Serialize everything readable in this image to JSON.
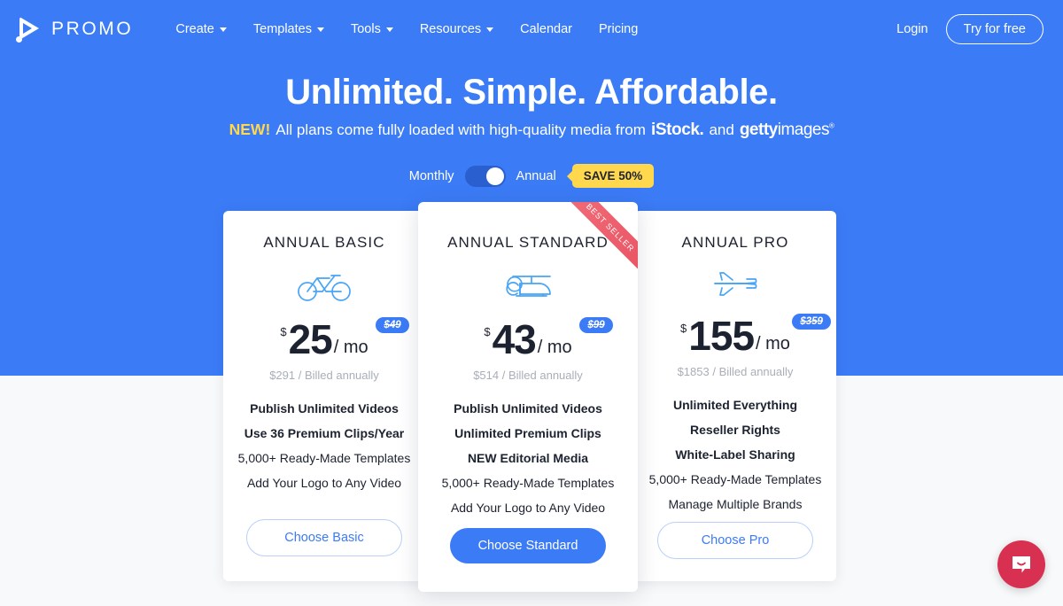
{
  "brand": {
    "name": "PROMO",
    "logo_icon": "play-triangle-icon"
  },
  "nav": {
    "items": [
      {
        "label": "Create",
        "has_caret": true
      },
      {
        "label": "Templates",
        "has_caret": true
      },
      {
        "label": "Tools",
        "has_caret": true
      },
      {
        "label": "Resources",
        "has_caret": true
      },
      {
        "label": "Calendar",
        "has_caret": false
      },
      {
        "label": "Pricing",
        "has_caret": false
      }
    ],
    "login_label": "Login",
    "try_label": "Try for free"
  },
  "hero": {
    "headline": "Unlimited. Simple. Affordable.",
    "new_flag": "NEW!",
    "subline_text": "All plans come fully loaded with high-quality media from",
    "partner_one": "iStock.",
    "conjunction": "and",
    "partner_two_bold": "getty",
    "partner_two_light": "images"
  },
  "billing": {
    "monthly_label": "Monthly",
    "annual_label": "Annual",
    "selected": "Annual",
    "save_badge": "SAVE 50%"
  },
  "colors": {
    "hero_blue": "#3b7bf6",
    "page_bg": "#f8f9fa",
    "accent_yellow": "#ffd84d",
    "ribbon_red": "#e8505f",
    "chat_red": "#d83050",
    "muted_gray": "#a9aeb8"
  },
  "plans": [
    {
      "id": "basic",
      "title": "ANNUAL BASIC",
      "icon": "bicycle-icon",
      "currency": "$",
      "amount": "25",
      "per": "/ mo",
      "old_price": "$49",
      "billed": "$291 / Billed annually",
      "features": [
        {
          "text": "Publish Unlimited Videos",
          "bold": true
        },
        {
          "text": "Use 36 Premium Clips/Year",
          "bold": true
        },
        {
          "text": "5,000+ Ready-Made Templates",
          "bold": false
        },
        {
          "text": "Add Your Logo to Any Video",
          "bold": false
        }
      ],
      "cta": "Choose Basic",
      "highlighted": false,
      "ribbon": null
    },
    {
      "id": "standard",
      "title": "ANNUAL STANDARD",
      "icon": "helicopter-icon",
      "currency": "$",
      "amount": "43",
      "per": "/ mo",
      "old_price": "$99",
      "billed": "$514 / Billed annually",
      "features": [
        {
          "text": "Publish Unlimited Videos",
          "bold": true
        },
        {
          "text": "Unlimited Premium Clips",
          "bold": true
        },
        {
          "text": "NEW Editorial Media",
          "bold": true
        },
        {
          "text": "5,000+ Ready-Made Templates",
          "bold": false
        },
        {
          "text": "Add Your Logo to Any Video",
          "bold": false
        }
      ],
      "cta": "Choose Standard",
      "highlighted": true,
      "ribbon": "BEST SELLER"
    },
    {
      "id": "pro",
      "title": "ANNUAL PRO",
      "icon": "airplane-icon",
      "currency": "$",
      "amount": "155",
      "per": "/ mo",
      "old_price": "$359",
      "billed": "$1853 / Billed annually",
      "features": [
        {
          "text": "Unlimited Everything",
          "bold": true
        },
        {
          "text": "Reseller Rights",
          "bold": true
        },
        {
          "text": "White-Label Sharing",
          "bold": true
        },
        {
          "text": "5,000+ Ready-Made Templates",
          "bold": false
        },
        {
          "text": "Manage Multiple Brands",
          "bold": false
        }
      ],
      "cta": "Choose Pro",
      "highlighted": false,
      "ribbon": null
    }
  ],
  "chat": {
    "icon": "chat-bubble-smile-icon"
  }
}
